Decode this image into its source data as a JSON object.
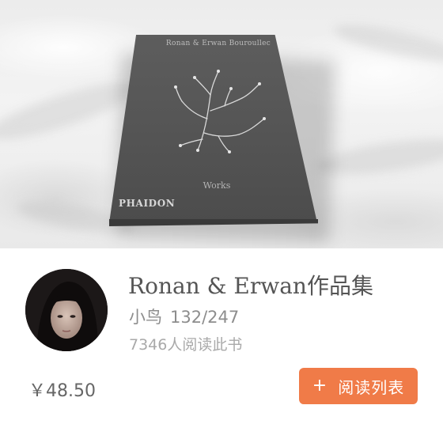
{
  "cover": {
    "book_title": "Ronan & Erwan Bouroullec",
    "book_subtitle": "Works",
    "publisher": "PHAIDON"
  },
  "book": {
    "title": "Ronan & Erwan作品集",
    "author": "小鸟",
    "progress": "132/247",
    "readers": "7346人阅读此书",
    "price": "￥48.50"
  },
  "actions": {
    "add_icon": "plus-icon",
    "add_label": "阅读列表",
    "add_plus": "+",
    "button_color": "#f07b48"
  }
}
